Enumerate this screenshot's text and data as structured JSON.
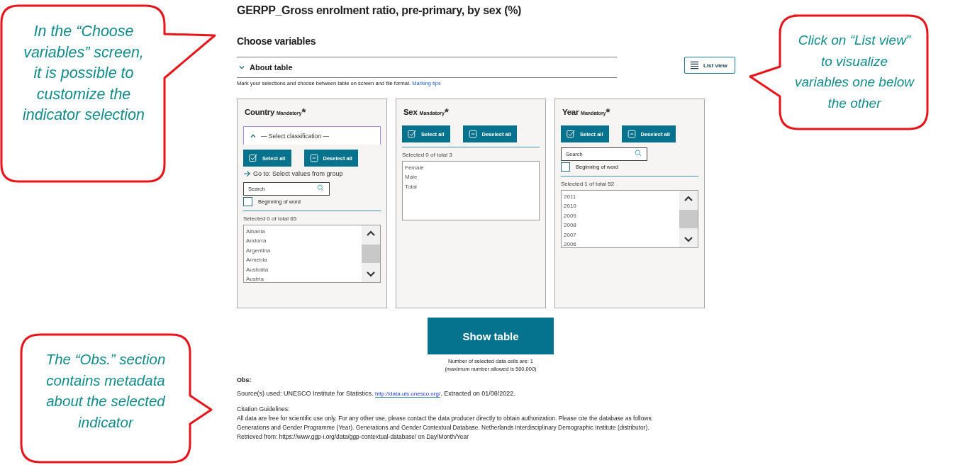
{
  "title": "GERPP_Gross enrolment ratio, pre-primary, by sex (%)",
  "section_title": "Choose variables",
  "about_table": {
    "label": "About table",
    "expanded": false
  },
  "intro": {
    "text": "Mark your selections and choose between table on screen and file format.",
    "link": "Marking tips"
  },
  "list_view_button": "List view",
  "variables": [
    {
      "name": "Country",
      "mandatory": "Mandatory",
      "required_mark": "*",
      "classification": "— Select classification —",
      "select_all": "Select all",
      "deselect_all": "Deselect all",
      "goto": "Go to: Select values from group",
      "search": {
        "placeholder": "Search"
      },
      "beginning_of_word": {
        "label": "Beginning of word",
        "checked": false
      },
      "count": "Selected 0 of total 65",
      "values": [
        "Albania",
        "Andorra",
        "Argentina",
        "Armenia",
        "Australia",
        "Austria"
      ],
      "scrollable": true
    },
    {
      "name": "Sex",
      "mandatory": "Mandatory",
      "required_mark": "*",
      "select_all": "Select all",
      "deselect_all": "Deselect all",
      "count": "Selected 0 of total 3",
      "values": [
        "Female",
        "Male",
        "Total"
      ],
      "scrollable": false
    },
    {
      "name": "Year",
      "mandatory": "Mandatory",
      "required_mark": "*",
      "select_all": "Select all",
      "deselect_all": "Deselect all",
      "search": {
        "placeholder": "Search"
      },
      "beginning_of_word": {
        "label": "Beginning of word",
        "checked": false
      },
      "count": "Selected 1 of total 52",
      "values": [
        "2011",
        "2010",
        "2009",
        "2008",
        "2007",
        "2006"
      ],
      "scrollable": true
    }
  ],
  "show_table_button": "Show table",
  "cell_count": "Number of selected data cells are:   1",
  "cell_limit": "(maximum number allowed is 500,000)",
  "obs": {
    "heading": "Obs:",
    "source_prefix": "Source(s) used: UNESCO Institute for Statistics.",
    "source_link": "http://data.uis.unesco.org/",
    "source_suffix": ". Extracted on 01/08/2022.",
    "citation_heading": "Citation Guidelines:",
    "citation_lines": [
      "All data are free for scientific use only. For any other use, please contact the data producer directly to obtain authorization. Please cite the database as follows:",
      "Generations and Gender Programme (Year). Generations and Gender Contextual Database. Netherlands Interdisciplinary Demographic Institute (distributor).",
      "Retrieved from: https://www.ggp-i.org/data/ggp-contextual-database/ on Day/Month/Year"
    ]
  },
  "callouts": [
    {
      "text": "In the “Choose variables” screen, it is possible to customize the indicator selection"
    },
    {
      "text": "Click on “List view” to visualize variables one below the other"
    },
    {
      "text": "The “Obs.” section contains metadata about the selected indicator"
    }
  ]
}
